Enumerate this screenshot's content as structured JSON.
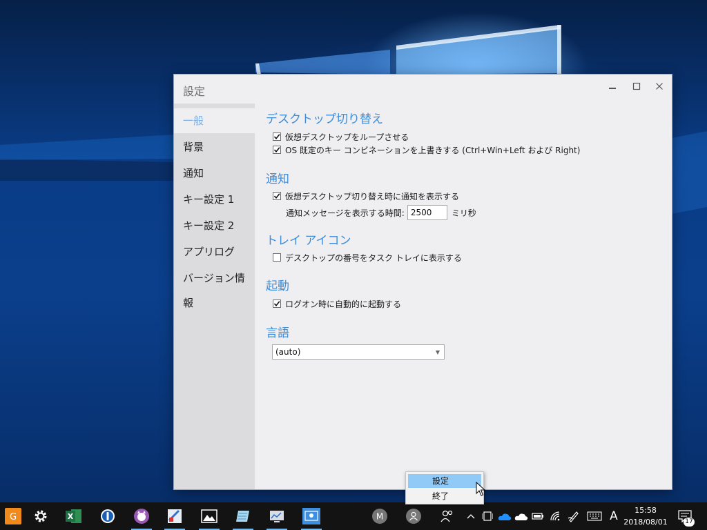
{
  "window": {
    "title": "設定",
    "controls": {
      "minimize": "minimize",
      "maximize": "maximize",
      "close": "close"
    }
  },
  "sidebar": {
    "items": [
      {
        "label": "一般",
        "active": true
      },
      {
        "label": "背景"
      },
      {
        "label": "通知"
      },
      {
        "label": "キー設定 1"
      },
      {
        "label": "キー設定 2"
      },
      {
        "label": "アプリログ"
      },
      {
        "label": "バージョン情報"
      }
    ]
  },
  "general": {
    "desktop_switch": {
      "heading": "デスクトップ切り替え",
      "loop_label": "仮想デスクトップをループさせる",
      "loop_checked": true,
      "override_label": "OS 既定のキー コンビネーションを上書きする (Ctrl+Win+Left および Right)",
      "override_checked": true
    },
    "notification": {
      "heading": "通知",
      "show_label": "仮想デスクトップ切り替え時に通知を表示する",
      "show_checked": true,
      "duration_label": "通知メッセージを表示する時間:",
      "duration_value": "2500",
      "duration_unit": "ミリ秒"
    },
    "tray": {
      "heading": "トレイ アイコン",
      "number_label": "デスクトップの番号をタスク トレイに表示する",
      "number_checked": false
    },
    "startup": {
      "heading": "起動",
      "logon_label": "ログオン時に自動的に起動する",
      "logon_checked": true
    },
    "language": {
      "heading": "言語",
      "selected": "(auto)"
    }
  },
  "context_menu": {
    "items": [
      "設定",
      "終了"
    ],
    "highlighted_index": 0
  },
  "taskbar": {
    "apps": [
      "app-launcher-icon",
      "settings-gear-icon",
      "excel-icon",
      "1password-icon",
      "cat-app-icon",
      "paint-app-icon",
      "photos-icon",
      "notepad-icon",
      "network-monitor-icon",
      "sylphy-icon"
    ],
    "avatar_initial": "M",
    "ime_label": "A",
    "time": "15:58",
    "date": "2018/08/01",
    "notification_count": "17"
  },
  "colors": {
    "accent": "#3d8ddb",
    "active_nav": "#7fb0e3",
    "menu_highlight": "#91c9f7",
    "taskbar": "#131313"
  }
}
